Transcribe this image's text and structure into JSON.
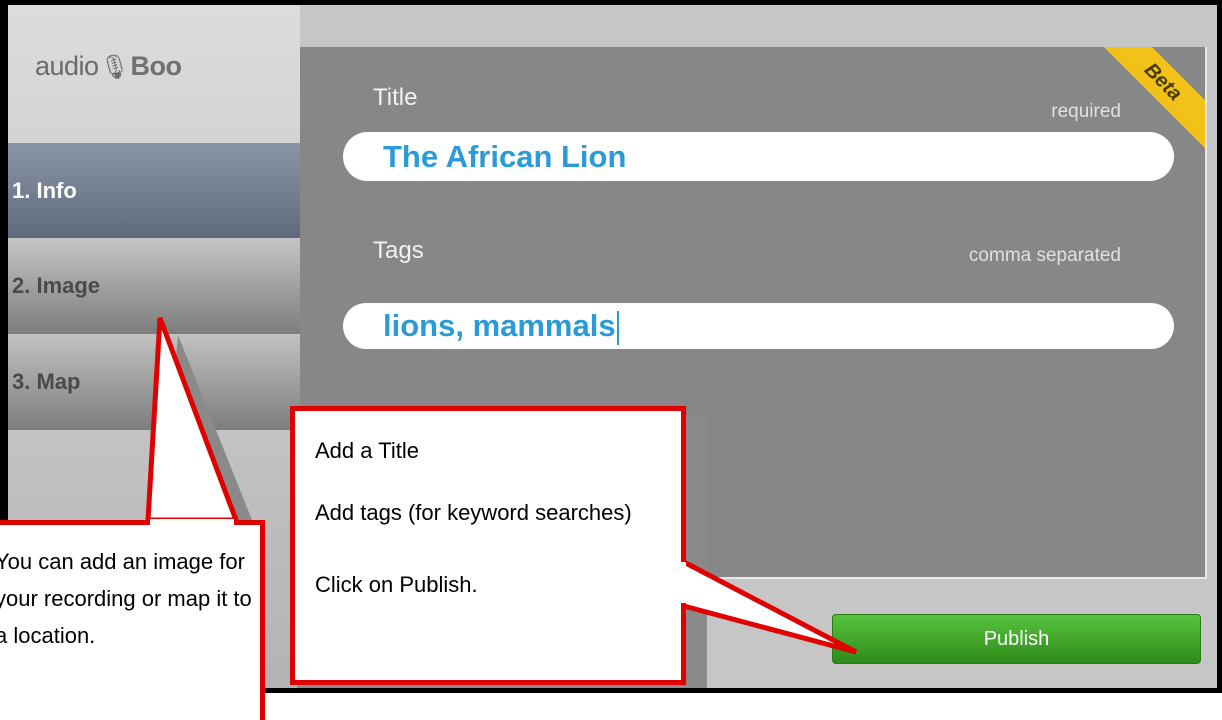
{
  "app": {
    "logo_prefix": "audio",
    "logo_suffix": "Boo",
    "beta": "Beta"
  },
  "sidebar": {
    "items": [
      {
        "label": "1. Info"
      },
      {
        "label": "2. Image"
      },
      {
        "label": "3. Map"
      }
    ]
  },
  "form": {
    "title_label": "Title",
    "title_hint": "required",
    "title_value": "The African Lion",
    "tags_label": "Tags",
    "tags_hint": "comma separated",
    "tags_value": "lions, mammals",
    "publish_label": "Publish"
  },
  "annotations": {
    "callout_steps": [
      "Add a Title",
      "Add tags (for keyword searches)",
      "Click on Publish."
    ],
    "callout_image": "You can add an image for your recording or map it to a location."
  },
  "colors": {
    "accent_text": "#2a9ad8",
    "publish_green": "#3aa627",
    "callout_border": "#e00000",
    "active_nav": "#6e798b"
  }
}
